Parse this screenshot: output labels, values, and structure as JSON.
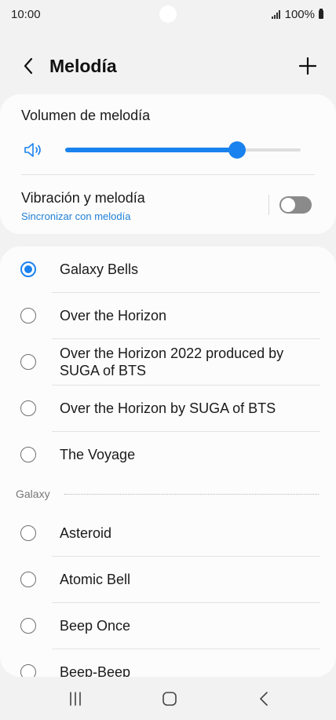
{
  "status_bar": {
    "time": "10:00",
    "battery": "100%"
  },
  "header": {
    "title": "Melodía",
    "back_icon": "chevron-left-icon",
    "add_icon": "plus-icon"
  },
  "settings": {
    "volume_label": "Volumen de melodía",
    "volume_level": 0.73,
    "vibration_label": "Vibración y melodía",
    "vibration_sub": "Sincronizar con melodía",
    "vibration_enabled": false,
    "accent_color": "#1a82ee"
  },
  "ringtones": {
    "items": [
      {
        "label": "Galaxy Bells",
        "selected": true
      },
      {
        "label": "Over the Horizon",
        "selected": false
      },
      {
        "label": "Over the Horizon 2022 produced by SUGA of BTS",
        "selected": false
      },
      {
        "label": "Over the Horizon by SUGA of BTS",
        "selected": false
      },
      {
        "label": "The Voyage",
        "selected": false
      }
    ],
    "section_label": "Galaxy",
    "galaxy_items": [
      {
        "label": "Asteroid",
        "selected": false
      },
      {
        "label": "Atomic Bell",
        "selected": false
      },
      {
        "label": "Beep Once",
        "selected": false
      },
      {
        "label": "Beep-Beep",
        "selected": false
      }
    ]
  },
  "nav": {
    "recents_icon": "recents-icon",
    "home_icon": "home-icon",
    "back_icon": "nav-back-icon"
  }
}
